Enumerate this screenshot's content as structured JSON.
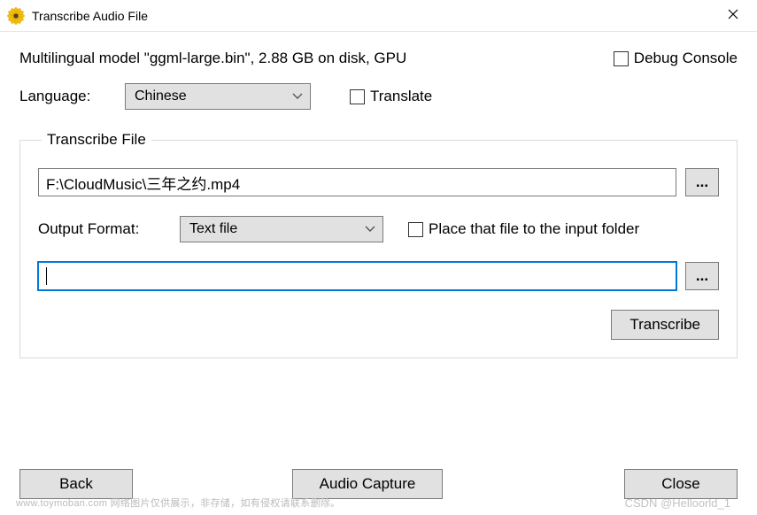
{
  "window": {
    "title": "Transcribe Audio File"
  },
  "model_info": "Multilingual model \"ggml-large.bin\", 2.88 GB on disk, GPU",
  "debug_console_label": "Debug Console",
  "debug_console_checked": false,
  "language": {
    "label": "Language:",
    "selected": "Chinese"
  },
  "translate": {
    "label": "Translate",
    "checked": false
  },
  "group": {
    "legend": "Transcribe File",
    "input_path": "F:\\CloudMusic\\三年之约.mp4",
    "browse_label": "...",
    "output_format": {
      "label": "Output Format:",
      "selected": "Text file"
    },
    "place_in_input_folder": {
      "label": "Place that file to the input folder",
      "checked": false
    },
    "output_path": "",
    "output_browse_label": "...",
    "transcribe_button": "Transcribe"
  },
  "buttons": {
    "back": "Back",
    "audio_capture": "Audio Capture",
    "close": "Close"
  },
  "watermark_left": "www.toymoban.com 网络图片仅供展示，非存储，如有侵权请联系删除。",
  "watermark_right": "CSDN @Helloorld_1"
}
